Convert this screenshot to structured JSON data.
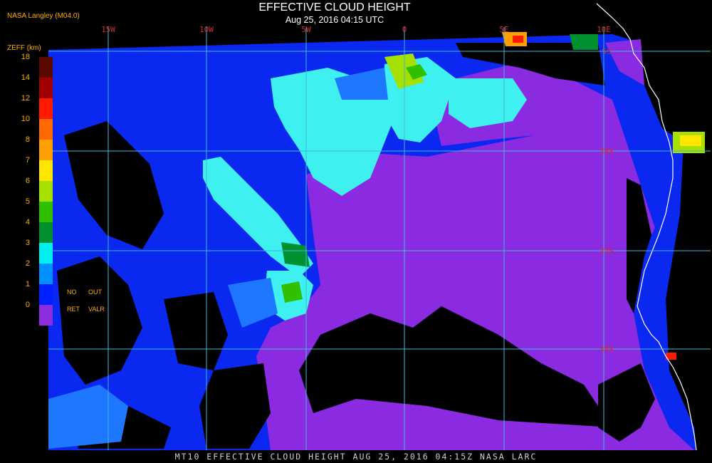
{
  "header": {
    "corner_label": "NASA Langley (M04.0)",
    "title": "EFFECTIVE CLOUD HEIGHT",
    "subtitle": "Aug 25, 2016 04:15 UTC"
  },
  "footer": {
    "text": "MT10  EFFECTIVE CLOUD HEIGHT   AUG 25, 2016 04:15Z   NASA LARC"
  },
  "colorbar": {
    "title": "ZEFF (km)",
    "ticks": [
      "18",
      "14",
      "12",
      "10",
      "8",
      "7",
      "6",
      "5",
      "4",
      "3",
      "2",
      "1",
      "0"
    ],
    "colors": [
      "#5a0a00",
      "#a00000",
      "#ff1a00",
      "#ff6a00",
      "#ffa000",
      "#ffe600",
      "#a6e000",
      "#30c000",
      "#009030",
      "#00f0f0",
      "#0090ff",
      "#0020ff",
      "#8c2ee0"
    ],
    "no_ret": {
      "line1_left": "NO",
      "line1_right": "OUT",
      "line2_left": "RET",
      "line2_right": "VALR"
    }
  },
  "map": {
    "lon_labels": [
      "15W",
      "10W",
      "5W",
      "0",
      "5E",
      "10E"
    ],
    "lat_labels": [
      "5S",
      "20S",
      "25S",
      "30S"
    ],
    "colors": {
      "grid": "#3fb8d6",
      "coast": "#ffffff",
      "deep_blue": "#0a28f0",
      "purple": "#8a2be2",
      "cyan": "#3ff0f0",
      "label_red": "#d03030"
    }
  }
}
